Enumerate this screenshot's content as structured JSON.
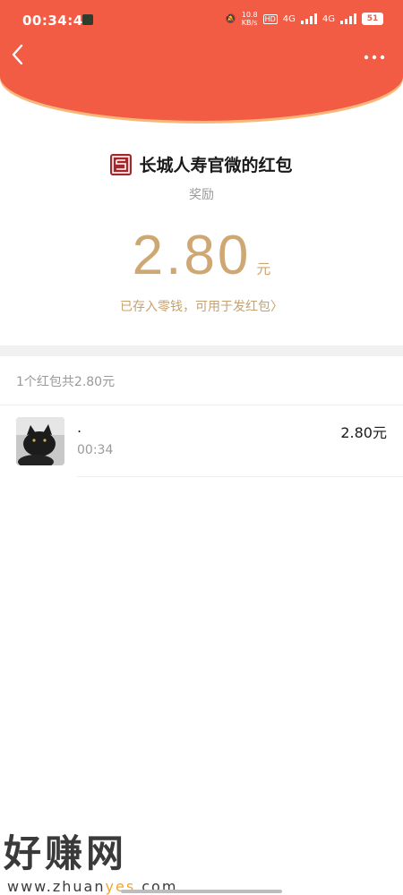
{
  "status_bar": {
    "time": "00:34:49",
    "speed_top": "10.8",
    "speed_unit": "KB/s",
    "hd_label": "HD",
    "net1": "4G",
    "net2": "4G",
    "battery": "51"
  },
  "header": {
    "back_icon": "chevron-left-icon",
    "more_icon": "more-icon",
    "color": "#f25c45"
  },
  "packet": {
    "sender_name": "长城人寿官微的红包",
    "memo": "奖励",
    "amount": "2.80",
    "unit": "元",
    "deposit_text": "已存入零钱，可用于发红包",
    "deposit_arrow": "〉",
    "accent_color": "#cfa772"
  },
  "summary": "1个红包共2.80元",
  "records": [
    {
      "name": ".",
      "time": "00:34",
      "amount": "2.80元"
    }
  ],
  "watermark": {
    "title": "好赚网",
    "url_a": "www.zhuan",
    "url_b": "yes",
    "url_c": ".com"
  }
}
